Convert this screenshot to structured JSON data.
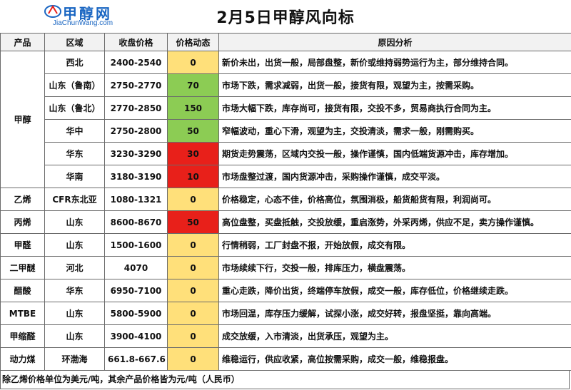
{
  "header": {
    "logo_cn": "甲醇网",
    "logo_en": "JiaChunWang.com",
    "title": "2月5日甲醇风向标"
  },
  "columns": [
    "产品",
    "区域",
    "收盘价格",
    "价格动态",
    "原因分析"
  ],
  "groups": [
    {
      "product": "甲醇",
      "rows": [
        {
          "region": "西北",
          "price": "2400-2540",
          "change": "0",
          "level": "flat",
          "reason": "新价未出，出货一般，局部盘整，新价或维持弱势运行为主，部分维持合同。"
        },
        {
          "region": "山东（鲁南）",
          "price": "2750-2770",
          "change": "70",
          "level": "up",
          "reason": "市场下跌，需求减弱，出货一般，接货有限，观望为主，按需采购。"
        },
        {
          "region": "山东（鲁北）",
          "price": "2770-2850",
          "change": "150",
          "level": "up",
          "reason": "市场大幅下跌，库存尚可，接货有限，交投不多，贸易商执行合同为主。"
        },
        {
          "region": "华中",
          "price": "2750-2800",
          "change": "50",
          "level": "up",
          "reason": "窄幅波动，重心下滑，观望为主，交投清淡，需求一般，刚需购买。"
        },
        {
          "region": "华东",
          "price": "3230-3290",
          "change": "30",
          "level": "down",
          "reason": "期货走势震荡，区域内交投一般，操作谨慎，国内低端货源冲击，库存增加。"
        },
        {
          "region": "华南",
          "price": "3180-3190",
          "change": "10",
          "level": "down",
          "reason": "市场盘整过渡，国内货源冲击，采购操作谨慎，成交平淡。"
        }
      ]
    },
    {
      "product": "乙烯",
      "rows": [
        {
          "region": "CFR东北亚",
          "price": "1080-1321",
          "change": "0",
          "level": "flat",
          "reason": "价格稳定，心态不佳，价格高位，氛围消极，船货船货有限，利润尚可。"
        }
      ]
    },
    {
      "product": "丙烯",
      "rows": [
        {
          "region": "山东",
          "price": "8600-8670",
          "change": "50",
          "level": "down",
          "reason": "高位盘整，买盘抵触，交投放缓，重启涨势，外采丙烯，供应不足，卖方操作谨慎。"
        }
      ]
    },
    {
      "product": "甲醛",
      "rows": [
        {
          "region": "山东",
          "price": "1500-1600",
          "change": "0",
          "level": "flat",
          "reason": "行情稍弱，工厂封盘不报，开始放假，成交有限。"
        }
      ]
    },
    {
      "product": "二甲醚",
      "rows": [
        {
          "region": "河北",
          "price": "4070",
          "change": "0",
          "level": "flat",
          "reason": "市场续续下行，交投一般，排库压力，横盘震荡。"
        }
      ]
    },
    {
      "product": "醋酸",
      "rows": [
        {
          "region": "华东",
          "price": "6950-7100",
          "change": "0",
          "level": "flat",
          "reason": "重心走跌，降价出货，终端停车放假，成交一般，库存低位，价格继续走跌。"
        }
      ]
    },
    {
      "product": "MTBE",
      "rows": [
        {
          "region": "山东",
          "price": "5800-5900",
          "change": "0",
          "level": "flat",
          "reason": "市场回温，库存压力缓解，试探小涨，成交好转，报盘坚挺，靠向高端。"
        }
      ]
    },
    {
      "product": "甲缩醛",
      "rows": [
        {
          "region": "山东",
          "price": "3900-4100",
          "change": "0",
          "level": "flat",
          "reason": "成交放缓，入市清淡，出货承压，观望为主。"
        }
      ]
    },
    {
      "product": "动力煤",
      "rows": [
        {
          "region": "环渤海",
          "price": "661.8-667.6",
          "change": "0",
          "level": "flat",
          "reason": "维稳运行，供应收紧，高位按需采购，成交一般，维稳报盘。"
        }
      ]
    }
  ],
  "footer": "除乙烯价格单位为美元/吨，其余产品价格皆为元/吨（人民币）",
  "colors": {
    "flat": "#ffe07a",
    "up": "#8ccc54",
    "down": "#e8201a",
    "brand": "#1a66c2"
  }
}
